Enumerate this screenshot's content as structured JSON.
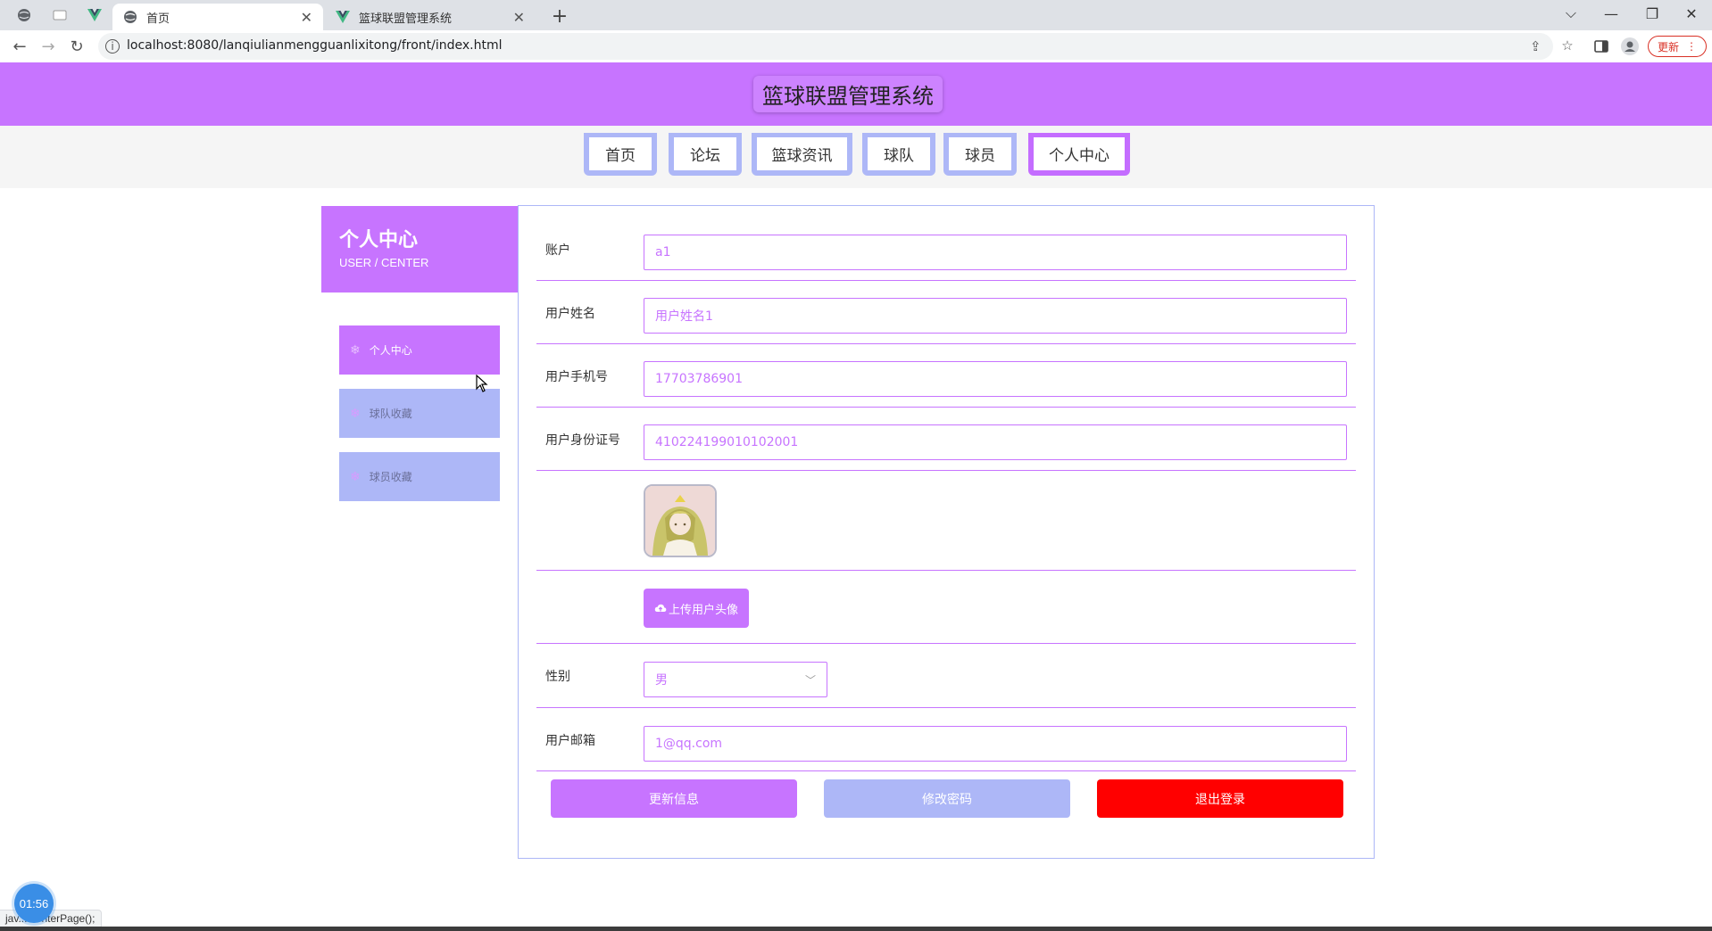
{
  "browser": {
    "tabs": [
      {
        "title": "首页",
        "active": true
      },
      {
        "title": "篮球联盟管理系统",
        "active": false
      }
    ],
    "url": "localhost:8080/lanqiulianmengguanlixitong/front/index.html",
    "update_label": "更新"
  },
  "header": {
    "site_title": "篮球联盟管理系统",
    "nav": [
      {
        "label": "首页",
        "active": false
      },
      {
        "label": "论坛",
        "active": false
      },
      {
        "label": "篮球资讯",
        "active": false
      },
      {
        "label": "球队",
        "active": false
      },
      {
        "label": "球员",
        "active": false
      },
      {
        "label": "个人中心",
        "active": true
      }
    ]
  },
  "sidebar": {
    "title": "个人中心",
    "subtitle": "USER / CENTER",
    "items": [
      {
        "label": "个人中心",
        "active": true
      },
      {
        "label": "球队收藏",
        "active": false
      },
      {
        "label": "球员收藏",
        "active": false
      }
    ]
  },
  "form": {
    "account": {
      "label": "账户",
      "value": "a1"
    },
    "name": {
      "label": "用户姓名",
      "value": "用户姓名1"
    },
    "phone": {
      "label": "用户手机号",
      "value": "17703786901"
    },
    "id_card": {
      "label": "用户身份证号",
      "value": "410224199010102001"
    },
    "upload_label": "上传用户头像",
    "gender": {
      "label": "性别",
      "value": "男"
    },
    "email": {
      "label": "用户邮箱",
      "value": "1@qq.com"
    }
  },
  "actions": {
    "update": "更新信息",
    "change_password": "修改密码",
    "logout": "退出登录"
  },
  "overlay": {
    "timer": "01:56",
    "status_text": "jav... centerPage();"
  },
  "colors": {
    "primary": "#c774ff",
    "secondary": "#adb7f7",
    "danger": "#ff0000"
  }
}
